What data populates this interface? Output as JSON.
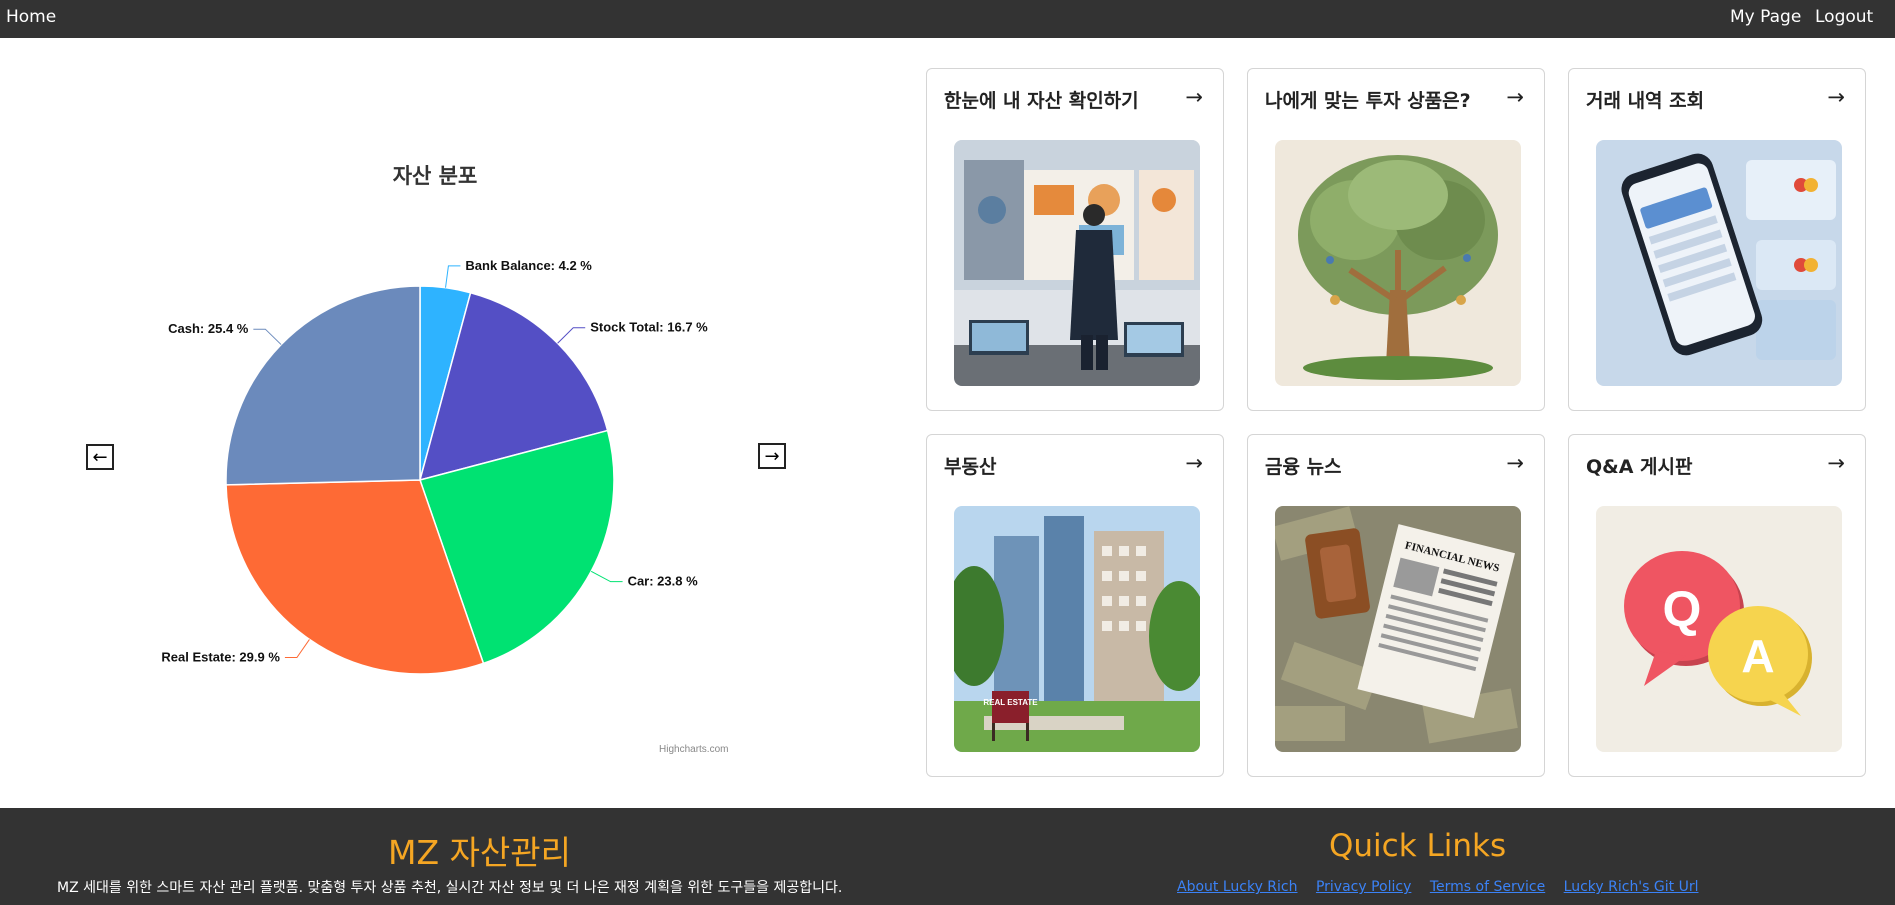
{
  "nav": {
    "home": "Home",
    "my_page": "My Page",
    "logout": "Logout"
  },
  "chart": {
    "prev_label": "←",
    "next_label": "→",
    "credit": "Highcharts.com"
  },
  "chart_data": {
    "type": "pie",
    "title": "자산 분포",
    "slices": [
      {
        "name": "Bank Balance",
        "value": 4.2,
        "label": "Bank Balance: 4.2 %",
        "color": "#2eb3ff"
      },
      {
        "name": "Stock Total",
        "value": 16.7,
        "label": "Stock Total: 16.7 %",
        "color": "#544fc5"
      },
      {
        "name": "Car",
        "value": 23.8,
        "label": "Car: 23.8 %",
        "color": "#00e272"
      },
      {
        "name": "Real Estate",
        "value": 29.9,
        "label": "Real Estate: 29.9 %",
        "color": "#fe6a35"
      },
      {
        "name": "Cash",
        "value": 25.4,
        "label": "Cash: 25.4 %",
        "color": "#6b8abc"
      }
    ]
  },
  "cards": [
    {
      "title": "한눈에 내 자산 확인하기",
      "arrow": "→",
      "icon": "asset-overview-illustration"
    },
    {
      "title": "나에게 맞는 투자 상품은?",
      "arrow": "→",
      "icon": "investment-tree-illustration"
    },
    {
      "title": "거래 내역 조회",
      "arrow": "→",
      "icon": "smartphone-transactions-illustration"
    },
    {
      "title": "부동산",
      "arrow": "→",
      "icon": "real-estate-buildings-illustration",
      "sign": "REAL ESTATE"
    },
    {
      "title": "금융 뉴스",
      "arrow": "→",
      "icon": "financial-news-illustration",
      "headline": "FINANCIAL NEWS"
    },
    {
      "title": "Q&A 게시판",
      "arrow": "→",
      "icon": "qa-bubbles-illustration",
      "q": "Q",
      "a": "A"
    }
  ],
  "footer": {
    "brand": "MZ 자산관리",
    "description": "MZ 세대를 위한 스마트 자산 관리 플랫폼. 맞춤형 투자 상품 추천, 실시간 자산 정보 및 더 나은 재정 계획을 위한 도구들을 제공합니다.",
    "quick_links_title": "Quick Links",
    "links": [
      "About Lucky Rich",
      "Privacy Policy",
      "Terms of Service",
      "Lucky Rich's Git Url"
    ]
  }
}
